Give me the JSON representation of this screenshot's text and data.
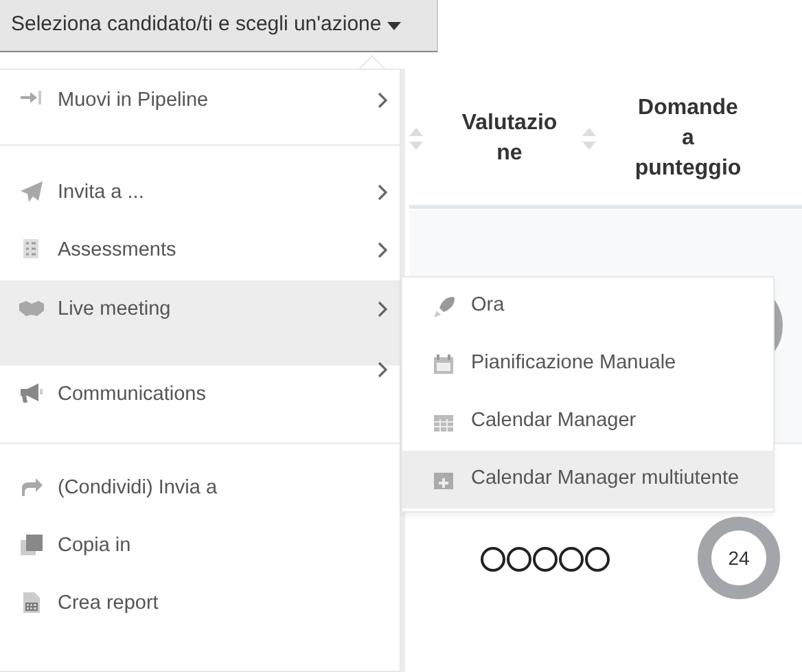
{
  "action_button": {
    "label": "Seleziona candidato/ti e scegli un'azione"
  },
  "table": {
    "columns": [
      {
        "label": "Valutazione"
      },
      {
        "label": "Domande a punteggio"
      }
    ],
    "rows": [
      {
        "stars": 0,
        "score": "24"
      }
    ]
  },
  "menu": {
    "groups": [
      [
        {
          "label": "Muovi in Pipeline",
          "has_submenu": true,
          "selected": false
        }
      ],
      [
        {
          "label": "Invita a ...",
          "has_submenu": true,
          "selected": false
        },
        {
          "label": "Assessments",
          "has_submenu": true,
          "selected": false
        },
        {
          "label": "Live meeting",
          "has_submenu": true,
          "selected": true
        },
        {
          "label": "Communications",
          "has_submenu": true,
          "selected": false
        }
      ],
      [
        {
          "label": "(Condividi) Invia a",
          "has_submenu": false,
          "selected": false
        },
        {
          "label": "Copia in",
          "has_submenu": false,
          "selected": false
        },
        {
          "label": "Crea report",
          "has_submenu": false,
          "selected": false
        }
      ]
    ]
  },
  "submenu": {
    "items": [
      {
        "label": "Ora",
        "selected": false
      },
      {
        "label": "Pianificazione Manuale",
        "selected": false
      },
      {
        "label": "Calendar Manager",
        "selected": false
      },
      {
        "label": "Calendar Manager multiutente",
        "selected": true
      }
    ]
  }
}
